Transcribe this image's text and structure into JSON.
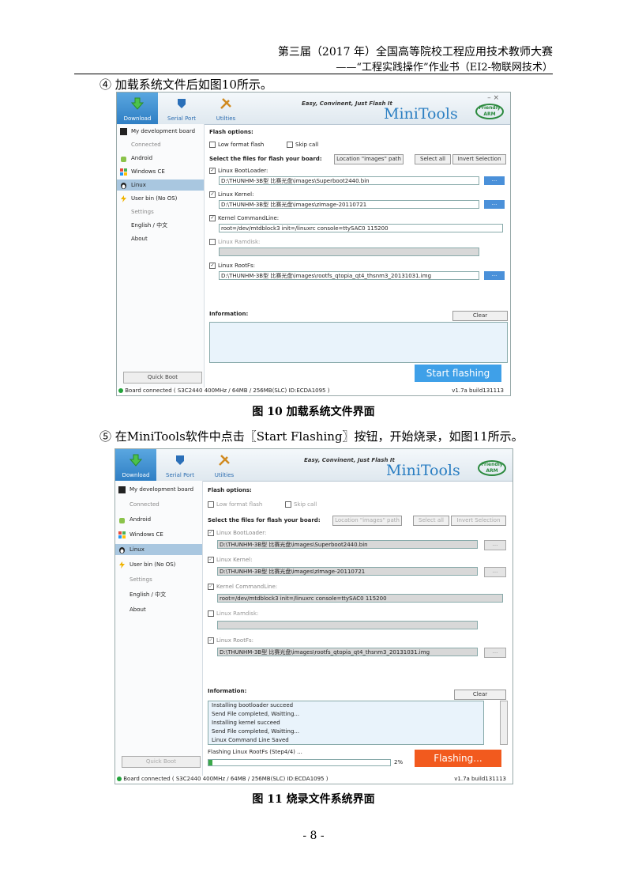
{
  "header": {
    "line1": "第三届（2017 年）全国高等院校工程应用技术教师大赛",
    "line2": "——“工程实践操作”作业书（EI2-物联网技术）"
  },
  "step4": "④ 加载系统文件后如图10所示。",
  "caption1": "图 10  加载系统文件界面",
  "step5": "⑤ 在MiniTools软件中点击〖Start Flashing〗按钮，开始烧录，如图11所示。",
  "caption2": "图 11  烧录文件系统界面",
  "page_number": "- 8 -",
  "app": {
    "toolbar": [
      "Download",
      "Serial Port",
      "Utilties"
    ],
    "slogan": "Easy, Convinent, Just Flash It",
    "brand": "MiniTools",
    "logo": "Friendly ARM",
    "win_controls": "–   ×",
    "sidebar": [
      "My development board",
      "Connected",
      "Android",
      "Windows CE",
      "Linux",
      "User bin (No OS)",
      "Settings",
      "English / 中文",
      "About"
    ],
    "quick_boot": "Quick Boot",
    "flash_options": "Flash options:",
    "low_format": "Low format flash",
    "skip_call": "Skip call",
    "select_files": "Select the files for flash your board:",
    "location_btn": "Location \"images\" path",
    "select_all": "Select all",
    "invert_sel": "Invert Selection",
    "bootloader_label": "Linux BootLoader:",
    "bootloader_path": "D:\\THUNHM-3B型 比赛光盘\\images\\Superboot2440.bin",
    "kernel_label": "Linux Kernel:",
    "kernel_path": "D:\\THUNHM-3B型 比赛光盘\\images\\zImage-20110721",
    "cmdline_label": "Kernel CommandLine:",
    "cmdline_value": "root=/dev/mtdblock3 init=/linuxrc console=ttySAC0 115200",
    "ramdisk_label": "Linux Ramdisk:",
    "rootfs_label": "Linux RootFs:",
    "rootfs_path": "D:\\THUNHM-3B型 比赛光盘\\images\\rootfs_qtopia_qt4_thsnm3_20131031.img",
    "dots": "...",
    "information": "Information:",
    "clear": "Clear",
    "start_flashing": "Start flashing",
    "flashing": "Flashing...",
    "status": "Board connected ( S3C2440 400MHz / 64MB / 256MB(SLC) ID:ECDA1095 )",
    "version": "v1.7a build131113",
    "log": [
      "Installing bootloader succeed",
      "Send File completed, Waitting...",
      "Installing kernel succeed",
      "Send File completed, Waitting...",
      "Linux Command Line Saved"
    ],
    "progress_text": "Flashing Linux RootFs (Step4/4) ...",
    "progress_pct": "2%",
    "progress_value": 0.02
  }
}
